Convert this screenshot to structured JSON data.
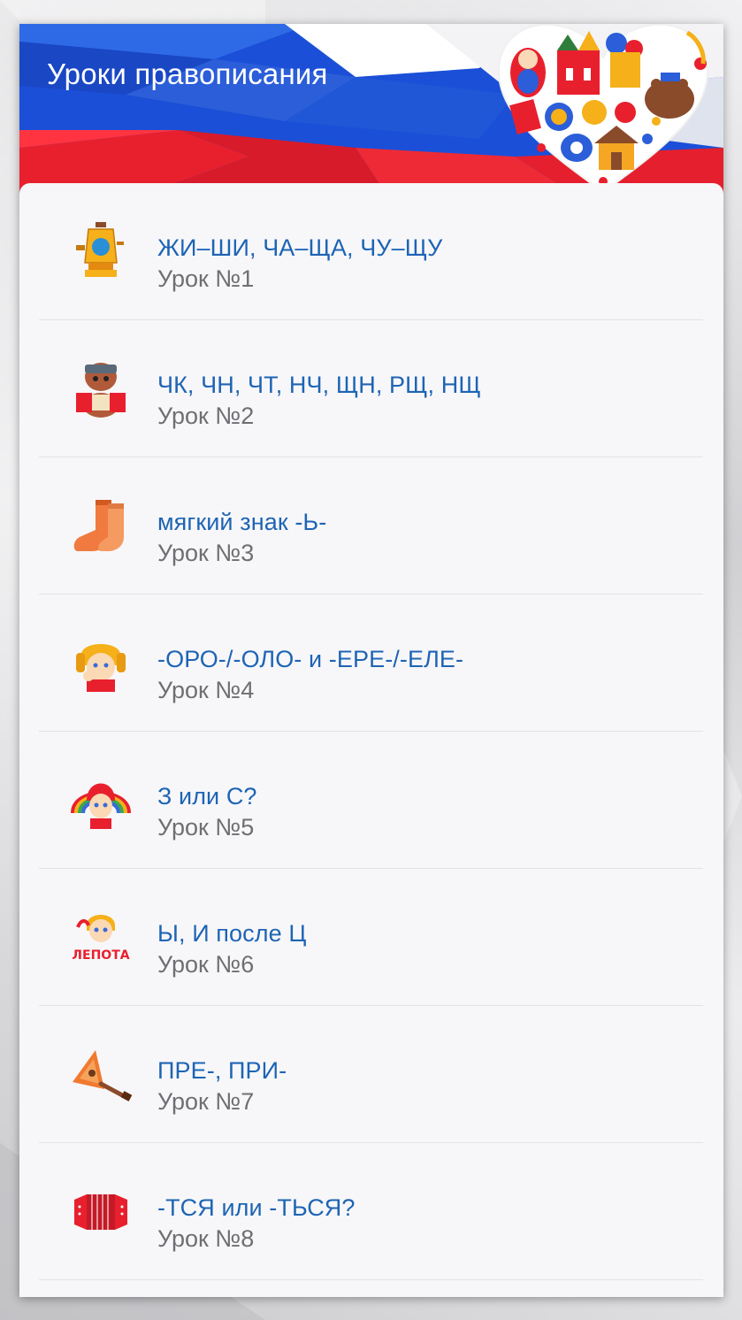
{
  "header": {
    "title": "Уроки правописания"
  },
  "colors": {
    "accent_blue": "#1e64b4",
    "flag_white": "#ffffff",
    "flag_blue": "#1b4fd8",
    "flag_red": "#e8202e",
    "subtitle_gray": "#6f6f73"
  },
  "lessons": [
    {
      "title": "ЖИ–ШИ, ЧА–ЩА, ЧУ–ЩУ",
      "subtitle": "Урок №1",
      "icon": "samovar-icon"
    },
    {
      "title": "ЧК, ЧН, ЧТ, НЧ, ЩН, РЩ, НЩ",
      "subtitle": "Урок №2",
      "icon": "bear-accordion-icon"
    },
    {
      "title": "мягкий знак -Ь-",
      "subtitle": "Урок №3",
      "icon": "valenki-icon"
    },
    {
      "title": "-ОРО-/-ОЛО- и -ЕРЕ-/-ЕЛЕ-",
      "subtitle": "Урок №4",
      "icon": "boy-ushanka-icon"
    },
    {
      "title": "З или С?",
      "subtitle": "Урок №5",
      "icon": "girl-kokoshnik-icon"
    },
    {
      "title": "Ы, И после Ц",
      "subtitle": "Урок №6",
      "icon": "boy-lepota-icon"
    },
    {
      "title": "ПРЕ-, ПРИ-",
      "subtitle": "Урок №7",
      "icon": "balalaika-icon"
    },
    {
      "title": "-ТСЯ или -ТЬСЯ?",
      "subtitle": "Урок №8",
      "icon": "accordion-icon"
    }
  ]
}
